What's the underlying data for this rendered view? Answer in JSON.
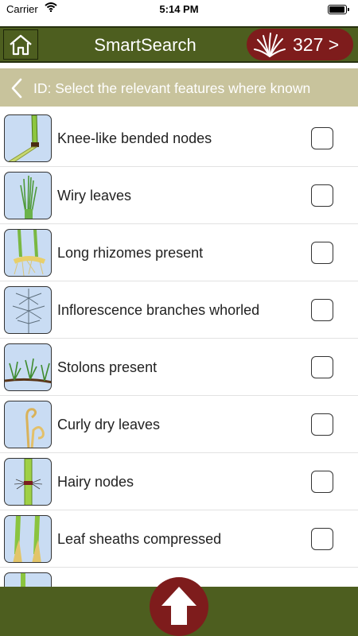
{
  "status_bar": {
    "carrier": "Carrier",
    "time": "5:14 PM"
  },
  "header": {
    "title": "SmartSearch",
    "result_count": "327 >"
  },
  "subheader": {
    "title": "ID: Select the relevant features where known"
  },
  "features": [
    {
      "label": "Knee-like bended nodes",
      "icon": "bent-node-icon",
      "checked": false
    },
    {
      "label": "Wiry leaves",
      "icon": "wiry-leaves-icon",
      "checked": false
    },
    {
      "label": "Long rhizomes present",
      "icon": "rhizome-icon",
      "checked": false
    },
    {
      "label": "Inflorescence branches whorled",
      "icon": "whorled-inflorescence-icon",
      "checked": false
    },
    {
      "label": "Stolons present",
      "icon": "stolon-icon",
      "checked": false
    },
    {
      "label": "Curly dry leaves",
      "icon": "curly-leaves-icon",
      "checked": false
    },
    {
      "label": "Hairy nodes",
      "icon": "hairy-node-icon",
      "checked": false
    },
    {
      "label": "Leaf sheaths compressed",
      "icon": "compressed-sheath-icon",
      "checked": false
    }
  ],
  "colors": {
    "header_green": "#4d5e1f",
    "accent_red": "#7e1c1c",
    "subheader_tan": "#c8c39c",
    "thumb_blue": "#c9dcf3"
  }
}
